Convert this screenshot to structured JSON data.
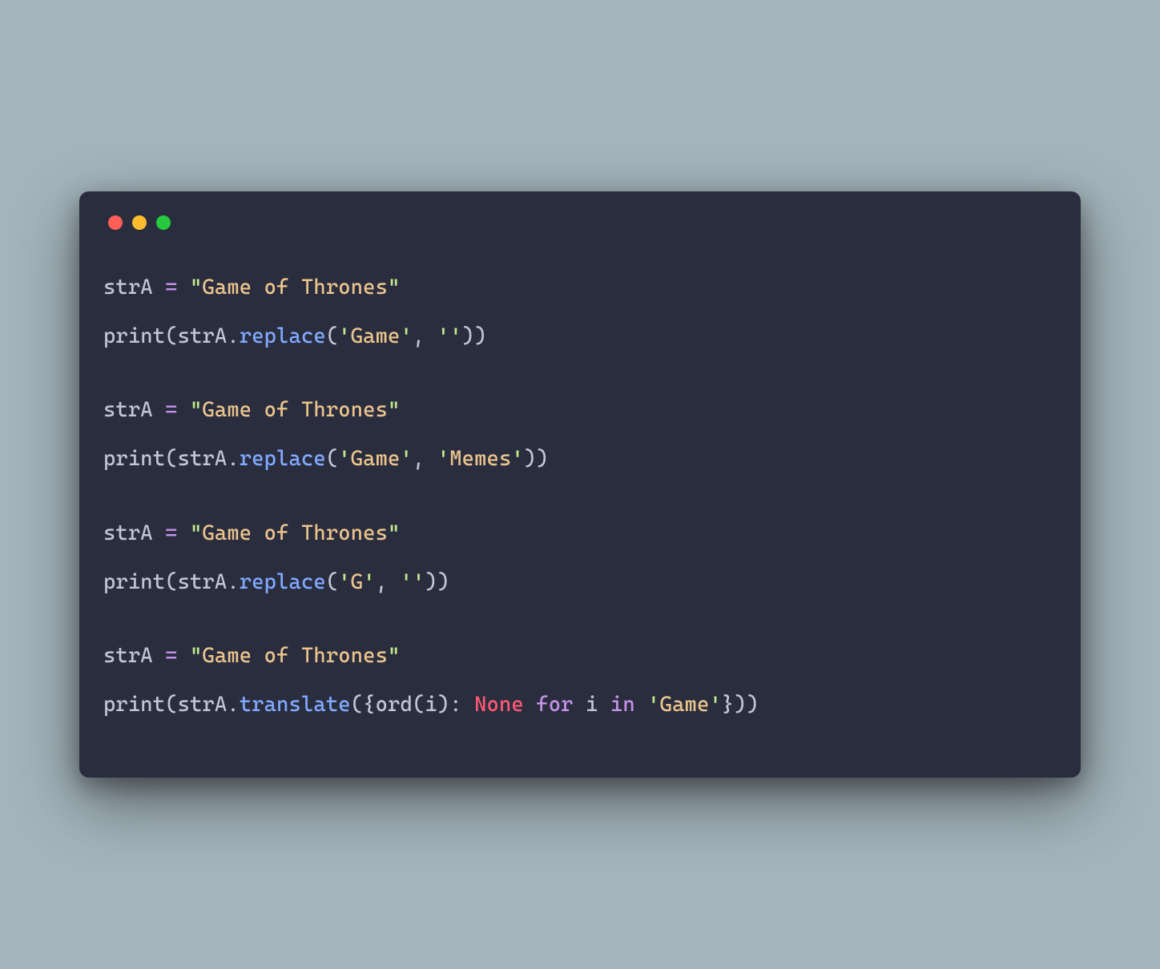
{
  "colors": {
    "bg": "#a4b4bc",
    "terminal_bg": "#292d3e",
    "red": "#ff5f56",
    "yellow": "#ffbd2e",
    "green": "#27c93f",
    "text": "#bfc7d5",
    "string_inner": "#ecc48d",
    "quote": "#c3e88d",
    "function": "#82aaff",
    "keyword": "#c792ea",
    "none": "#ff5874"
  },
  "code": {
    "blocks": [
      {
        "assign": {
          "var": "strA",
          "op": "=",
          "q": "\"",
          "val": "Game of Thrones"
        },
        "call": {
          "fn": "print",
          "obj": "strA",
          "method": "replace",
          "args": [
            {
              "q": "'",
              "val": "Game"
            },
            {
              "q": "'",
              "val": ""
            }
          ]
        }
      },
      {
        "assign": {
          "var": "strA",
          "op": "=",
          "q": "\"",
          "val": "Game of Thrones"
        },
        "call": {
          "fn": "print",
          "obj": "strA",
          "method": "replace",
          "args": [
            {
              "q": "'",
              "val": "Game"
            },
            {
              "q": "'",
              "val": "Memes"
            }
          ]
        }
      },
      {
        "assign": {
          "var": "strA",
          "op": "=",
          "q": "\"",
          "val": "Game of Thrones"
        },
        "call": {
          "fn": "print",
          "obj": "strA",
          "method": "replace",
          "args": [
            {
              "q": "'",
              "val": "G"
            },
            {
              "q": "'",
              "val": ""
            }
          ]
        }
      },
      {
        "assign": {
          "var": "strA",
          "op": "=",
          "q": "\"",
          "val": "Game of Thrones"
        },
        "call_translate": {
          "fn": "print",
          "obj": "strA",
          "method": "translate",
          "inner_fn": "ord",
          "inner_var": "i",
          "none": "None",
          "for_kw": "for",
          "loop_var": "i",
          "in_kw": "in",
          "iter_q": "'",
          "iter_val": "Game"
        }
      }
    ]
  }
}
